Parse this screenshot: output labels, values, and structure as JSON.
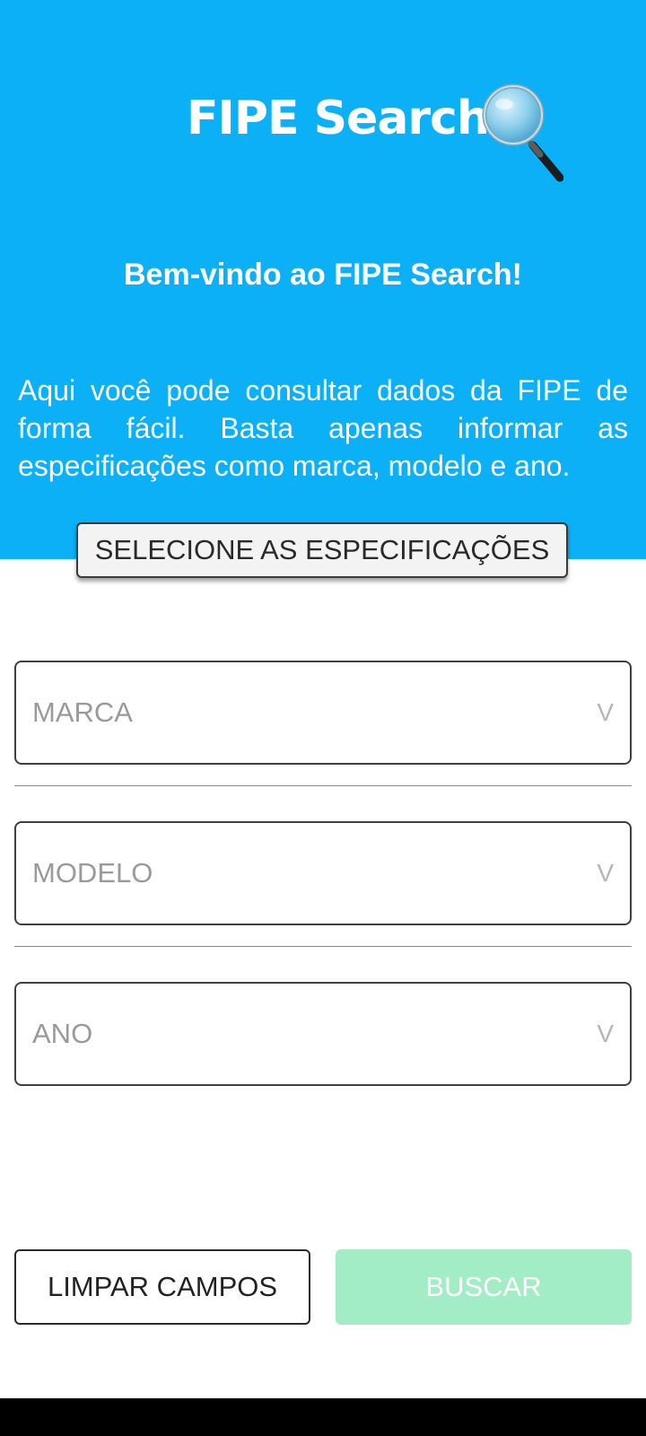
{
  "app": {
    "title": "FIPE Search",
    "icon": "magnifying-glass-icon"
  },
  "welcome": {
    "heading": "Bem-vindo ao FIPE Search!",
    "description": "Aqui você pode consultar dados da FIPE de forma fácil. Basta apenas informar as especificações como marca, modelo e ano."
  },
  "spec_button": {
    "label": "SELECIONE AS ESPECIFICAÇÕES"
  },
  "selects": {
    "marca": {
      "placeholder": "MARCA",
      "chevron": "V"
    },
    "modelo": {
      "placeholder": "MODELO",
      "chevron": "V"
    },
    "ano": {
      "placeholder": "ANO",
      "chevron": "V"
    }
  },
  "actions": {
    "clear_label": "LIMPAR CAMPOS",
    "search_label": "BUSCAR"
  },
  "colors": {
    "header_bg": "#0BB0F7",
    "search_button_disabled": "#A2ECC6",
    "placeholder_text": "#9a9a9a"
  }
}
